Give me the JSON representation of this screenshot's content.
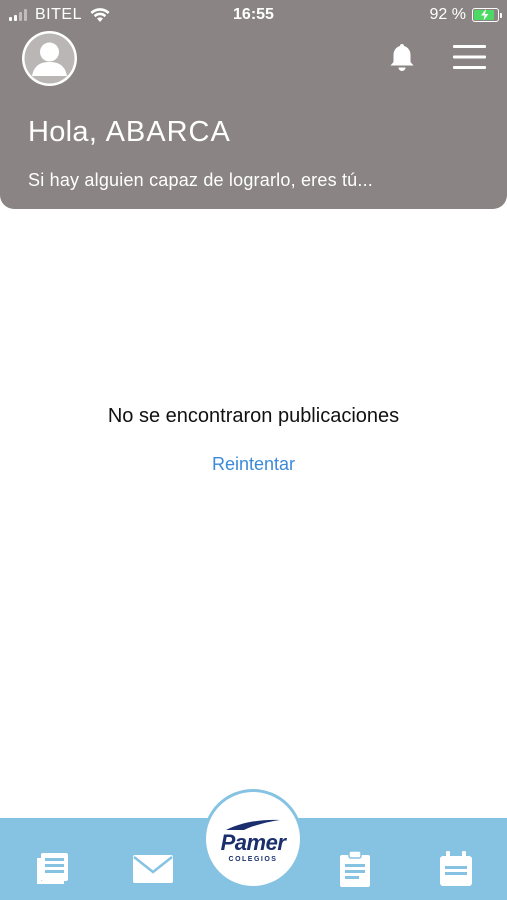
{
  "status_bar": {
    "carrier": "BITEL",
    "time": "16:55",
    "battery_percent_label": "92 %",
    "battery_level": 0.92,
    "signal_bars_active": 2,
    "signal_bars_total": 4
  },
  "header": {
    "greeting_prefix": "Hola, ",
    "user_name": "ABARCA",
    "subtitle": "Si hay alguien capaz de lograrlo, eres tú..."
  },
  "main": {
    "empty_message": "No se encontraron publicaciones",
    "retry_label": "Reintentar"
  },
  "bottom_nav": {
    "logo_text": "Pamer",
    "logo_subtext": "COLEGIOS",
    "items": [
      {
        "icon": "news-icon"
      },
      {
        "icon": "mail-icon"
      },
      {
        "icon": "clipboard-icon"
      },
      {
        "icon": "calendar-icon"
      }
    ]
  },
  "colors": {
    "header_bg": "#8a8584",
    "nav_bg": "#86c3e3",
    "link": "#3b8ad9",
    "logo": "#1b2f6e",
    "battery_fill": "#4cd964"
  }
}
